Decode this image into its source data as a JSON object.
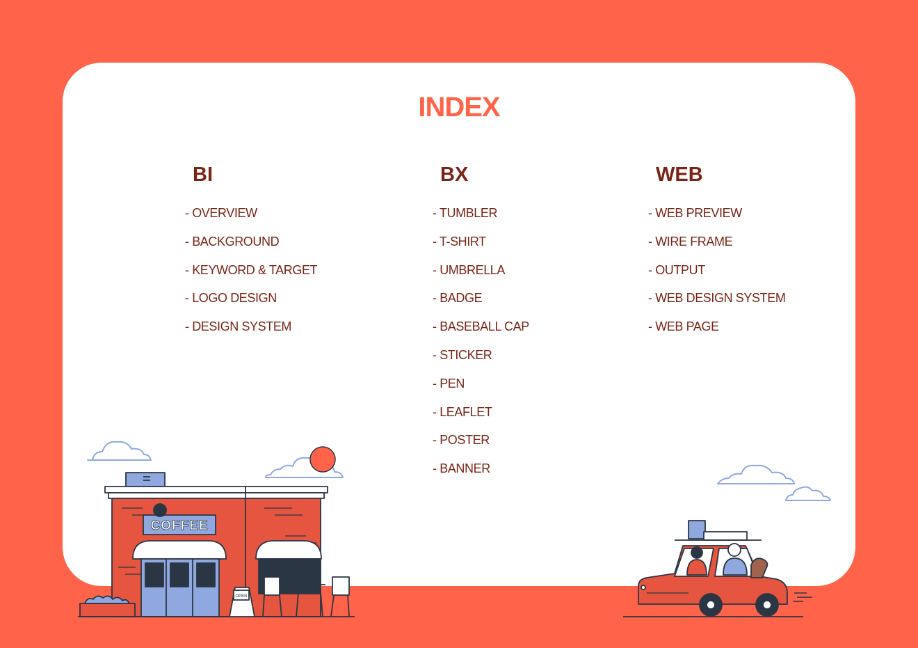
{
  "title": "INDEX",
  "columns": [
    {
      "heading": "BI",
      "items": [
        "- OVERVIEW",
        "- BACKGROUND",
        "- KEYWORD & TARGET",
        "- LOGO DESIGN",
        "- DESIGN SYSTEM"
      ]
    },
    {
      "heading": "BX",
      "items": [
        "- TUMBLER",
        "- T-SHIRT",
        "- UMBRELLA",
        "- BADGE",
        "- BASEBALL CAP",
        "- STICKER",
        "- PEN",
        "- LEAFLET",
        "- POSTER",
        "- BANNER"
      ]
    },
    {
      "heading": "WEB",
      "items": [
        "- WEB PREVIEW",
        "- WIRE FRAME",
        "- OUTPUT",
        "- WEB DESIGN SYSTEM",
        "- WEB PAGE"
      ]
    }
  ],
  "illustration": {
    "shop_sign": "COFFEE",
    "open_sign": "OPEN"
  },
  "colors": {
    "background": "#FF644A",
    "card": "#FFFFFF",
    "title": "#FF644A",
    "text": "#7A2418",
    "outline": "#2B3645",
    "accent_blue": "#8FA8E0"
  }
}
